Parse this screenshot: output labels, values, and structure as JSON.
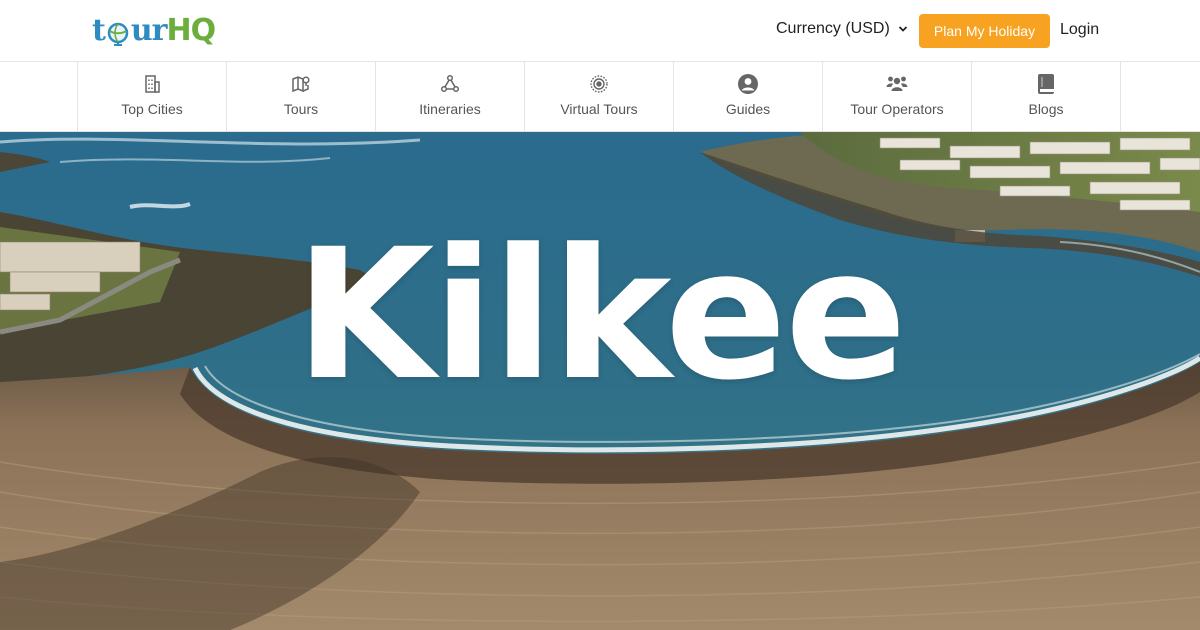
{
  "brand": {
    "logo_part1": "t",
    "logo_part2": "ur",
    "logo_part3": "HQ"
  },
  "header": {
    "currency_label": "Currency (USD)",
    "plan_button": "Plan My Holiday",
    "login": "Login"
  },
  "nav": {
    "items": [
      {
        "label": "Top Cities",
        "icon": "building-icon"
      },
      {
        "label": "Tours",
        "icon": "map-pin-icon"
      },
      {
        "label": "Itineraries",
        "icon": "route-icon"
      },
      {
        "label": "Virtual Tours",
        "icon": "virtual-tour-icon"
      },
      {
        "label": "Guides",
        "icon": "user-circle-icon"
      },
      {
        "label": "Tour Operators",
        "icon": "users-icon"
      },
      {
        "label": "Blogs",
        "icon": "book-icon"
      }
    ]
  },
  "hero": {
    "title": "Kilkee"
  },
  "colors": {
    "accent_orange": "#f7a221",
    "logo_blue": "#2e8bc0",
    "logo_green": "#6cae3e"
  }
}
